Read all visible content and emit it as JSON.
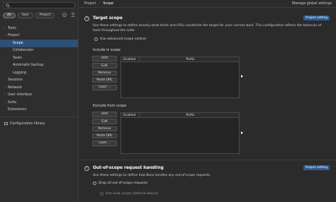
{
  "sidebar": {
    "search": {
      "value": "",
      "placeholder": ""
    },
    "filters": [
      "All",
      "User",
      "Project"
    ],
    "items": [
      {
        "label": "Tools",
        "chevron": "›"
      },
      {
        "label": "Project",
        "chevron": "⌄"
      },
      {
        "label": "Scope"
      },
      {
        "label": "Collaborator"
      },
      {
        "label": "Tasks"
      },
      {
        "label": "Automatic backup"
      },
      {
        "label": "Logging"
      },
      {
        "label": "Sessions"
      },
      {
        "label": "Network",
        "chevron": "›"
      },
      {
        "label": "User interface",
        "chevron": "›"
      },
      {
        "label": "Suite",
        "chevron": "›"
      },
      {
        "label": "Extensions"
      }
    ],
    "library": "Configuration library"
  },
  "breadcrumb": {
    "part1": "Project",
    "part2": "Scope"
  },
  "manage_link": "Manage global settings",
  "target_scope": {
    "title": "Target scope",
    "badge": "Project setting",
    "desc": "Use these settings to define exactly what hosts and URLs constitute the target for your current work. This configuration affects the behavior of tools throughout the suite.",
    "advanced": "Use advanced scope control",
    "include_label": "Include in scope",
    "exclude_label": "Exclude from scope",
    "buttons": [
      "Add",
      "Edit",
      "Remove",
      "Paste URL",
      "Load ..."
    ],
    "columns": [
      "Enabled",
      "Prefix"
    ]
  },
  "oos": {
    "title": "Out-of-scope request handling",
    "badge": "Project setting",
    "desc": "Use these settings to define how Burp handles any out-of-scope requests.",
    "drop_all": "Drop all out-of-scope requests",
    "use_suite": "Use suite scope [defined above]"
  },
  "colors": {
    "accent": "#2f4f73",
    "badge": "#2e5b93",
    "background": "#2b2b2b"
  },
  "icons": [
    "search-icon",
    "question-icon",
    "filter-icon",
    "collapse-icon",
    "library-icon"
  ]
}
